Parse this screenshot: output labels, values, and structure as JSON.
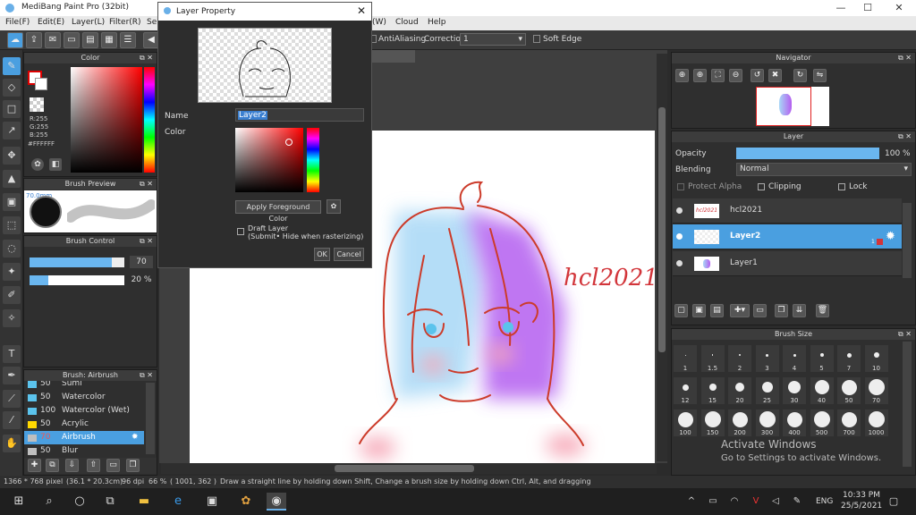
{
  "app": {
    "title": "MediBang Paint Pro (32bit)"
  },
  "window_controls": {
    "minimize": "—",
    "maximize": "☐",
    "close": "✕"
  },
  "menu": [
    "File(F)",
    "Edit(E)",
    "Layer(L)",
    "Filter(R)",
    "Se",
    "(W)",
    "Cloud",
    "Help"
  ],
  "toolbar": {
    "antialiasing": "AntiAliasing",
    "correction_label": "Correction",
    "correction_value": "1",
    "soft_edge": "Soft Edge"
  },
  "color_panel": {
    "title": "Color",
    "r": "R:255",
    "g": "G:255",
    "b": "B:255",
    "hex": "#FFFFFF"
  },
  "brush_preview": {
    "title": "Brush Preview",
    "size": "70.0mm"
  },
  "brush_control": {
    "title": "Brush Control",
    "size_value": "70",
    "size_fill": 0.87,
    "opacity_value": "20 %",
    "opacity_fill": 0.2
  },
  "brush_list": {
    "title": "Brush: Airbrush",
    "items": [
      {
        "size": "50",
        "name": "Sumi",
        "color": "#5bc3ec"
      },
      {
        "size": "50",
        "name": "Watercolor",
        "color": "#5bc3ec"
      },
      {
        "size": "100",
        "name": "Watercolor (Wet)",
        "color": "#5bc3ec"
      },
      {
        "size": "50",
        "name": "Acrylic",
        "color": "#ffd800"
      },
      {
        "size": "70",
        "name": "Airbrush",
        "color": "#bfbfbf"
      },
      {
        "size": "50",
        "name": "Blur",
        "color": "#bfbfbf"
      }
    ]
  },
  "dialog": {
    "title": "Layer Property",
    "name_label": "Name",
    "name_value": "Layer2",
    "color_label": "Color",
    "apply_fg": "Apply Foreground Color",
    "draft_label": "Draft Layer",
    "draft_note": "(Submit• Hide when rasterizing)",
    "ok": "OK",
    "cancel": "Cancel"
  },
  "canvas": {
    "signature": "hcl2021"
  },
  "navigator": {
    "title": "Navigator"
  },
  "layer_panel": {
    "title": "Layer",
    "opacity_label": "Opacity",
    "opacity_value": "100 %",
    "blending_label": "Blending",
    "blending_value": "Normal",
    "protect_alpha": "Protect Alpha",
    "clipping": "Clipping",
    "lock": "Lock",
    "layers": [
      {
        "name": "hcl2021",
        "thumb": "hcl2021"
      },
      {
        "name": "Layer2",
        "badge": "1"
      },
      {
        "name": "Layer1"
      }
    ]
  },
  "brush_size": {
    "title": "Brush Size",
    "sizes": [
      "1",
      "1.5",
      "2",
      "3",
      "4",
      "5",
      "7",
      "10",
      "12",
      "15",
      "20",
      "25",
      "30",
      "40",
      "50",
      "70",
      "100",
      "150",
      "200",
      "300",
      "400",
      "500",
      "700",
      "1000"
    ]
  },
  "watermark": {
    "line1": "Activate Windows",
    "line2": "Go to Settings to activate Windows."
  },
  "statusbar": {
    "dims": "1366 * 768 pixel",
    "cm": "(36.1 * 20.3cm)",
    "dpi": "96 dpi",
    "zoom": "66 %",
    "coords": "( 1001, 362 )",
    "hint": "Draw a straight line by holding down Shift, Change a brush size by holding down Ctrl, Alt, and dragging"
  },
  "taskbar": {
    "lang": "ENG",
    "time": "10:33 PM",
    "date": "25/5/2021"
  },
  "colors": {
    "accent": "#4a9fe0",
    "selected_layer": "#4a9fe0",
    "signature": "#d2353a"
  }
}
